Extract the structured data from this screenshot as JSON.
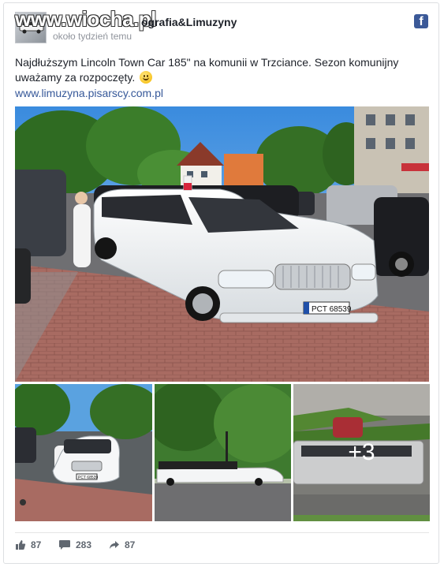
{
  "post": {
    "page_name": "P... ...ografia&Limuzyny",
    "page_name_visible_suffix": "ografia&Limuzyny",
    "timestamp": "około tydzień temu",
    "text": "Najdłuższym Lincoln Town Car 185\" na komunii w Trzciance. Sezon komunijny uważamy za rozpoczęty.",
    "link": "www.limuzyna.pisarscy.com.pl",
    "more_photos": "+3",
    "platform_icon": "facebook-icon",
    "emoji": "smiling-face-emoji"
  },
  "watermark": {
    "text": "www.wiocha.pl"
  },
  "main_photo": {
    "plate": "PCT 68539"
  },
  "thumb_photos": {
    "plate": "PCT 68539"
  },
  "footer": {
    "reactions": "87",
    "comments": "283",
    "shares": "87"
  },
  "colors": {
    "link": "#365899",
    "facebook_brand": "#3b5998",
    "secondary_text": "#90949c"
  }
}
